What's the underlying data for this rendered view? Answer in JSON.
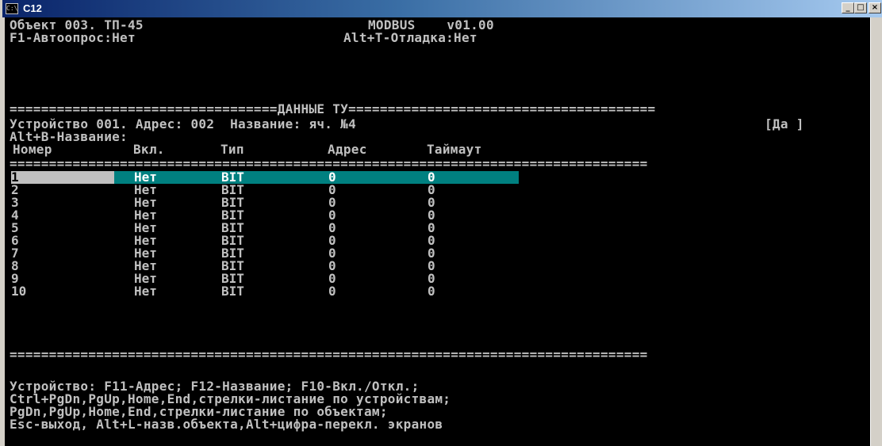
{
  "window": {
    "title": "C12",
    "icon_text": "C:\\",
    "icon_name": "console-icon",
    "min_label": "_",
    "max_label": "□",
    "close_label": "×"
  },
  "header": {
    "line1_left": "Объект 003. ТП-45",
    "line1_right": "MODBUS    v01.00",
    "line2_left": "F1-Автоопрос:Нет",
    "line2_right": "Alt+T-Отладка:Нет"
  },
  "section": {
    "divider_title": "==================================ДАННЫЕ ТУ=======================================",
    "device_line": "Устройство 001. Адрес: 002  Название: яч. №4",
    "device_flag": "[Да ]",
    "rename_hint": "Alt+B-Название:"
  },
  "table": {
    "columns": [
      "Номер",
      "Вкл.",
      "Тип",
      "Адрес",
      "Таймаут"
    ],
    "divider": "=================================================================================",
    "rows": [
      {
        "num": "1",
        "on": "Нет",
        "type": "BIT",
        "addr": "0",
        "timeout": "0"
      },
      {
        "num": "2",
        "on": "Нет",
        "type": "BIT",
        "addr": "0",
        "timeout": "0"
      },
      {
        "num": "3",
        "on": "Нет",
        "type": "BIT",
        "addr": "0",
        "timeout": "0"
      },
      {
        "num": "4",
        "on": "Нет",
        "type": "BIT",
        "addr": "0",
        "timeout": "0"
      },
      {
        "num": "5",
        "on": "Нет",
        "type": "BIT",
        "addr": "0",
        "timeout": "0"
      },
      {
        "num": "6",
        "on": "Нет",
        "type": "BIT",
        "addr": "0",
        "timeout": "0"
      },
      {
        "num": "7",
        "on": "Нет",
        "type": "BIT",
        "addr": "0",
        "timeout": "0"
      },
      {
        "num": "8",
        "on": "Нет",
        "type": "BIT",
        "addr": "0",
        "timeout": "0"
      },
      {
        "num": "9",
        "on": "Нет",
        "type": "BIT",
        "addr": "0",
        "timeout": "0"
      },
      {
        "num": "10",
        "on": "Нет",
        "type": "BIT",
        "addr": "0",
        "timeout": "0"
      }
    ],
    "bottom_divider": "================================================================================="
  },
  "help": {
    "line1": "Устройство: F11-Адрес; F12-Название; F10-Вкл./Откл.;",
    "line2": "Ctrl+PgDn,PgUp,Home,End,стрелки-листание по устройствам;",
    "line3": "PgDn,PgUp,Home,End,стрелки-листание по объектам;",
    "line4": "Esc-выход, Alt+L-назв.объекта,Alt+цифра-перекл. экранов"
  },
  "colors": {
    "console_bg": "#000000",
    "console_text": "#c0c0c0",
    "selection_bg": "#008080",
    "selection_text": "#ffffff",
    "titlebar_start": "#0a246a"
  }
}
